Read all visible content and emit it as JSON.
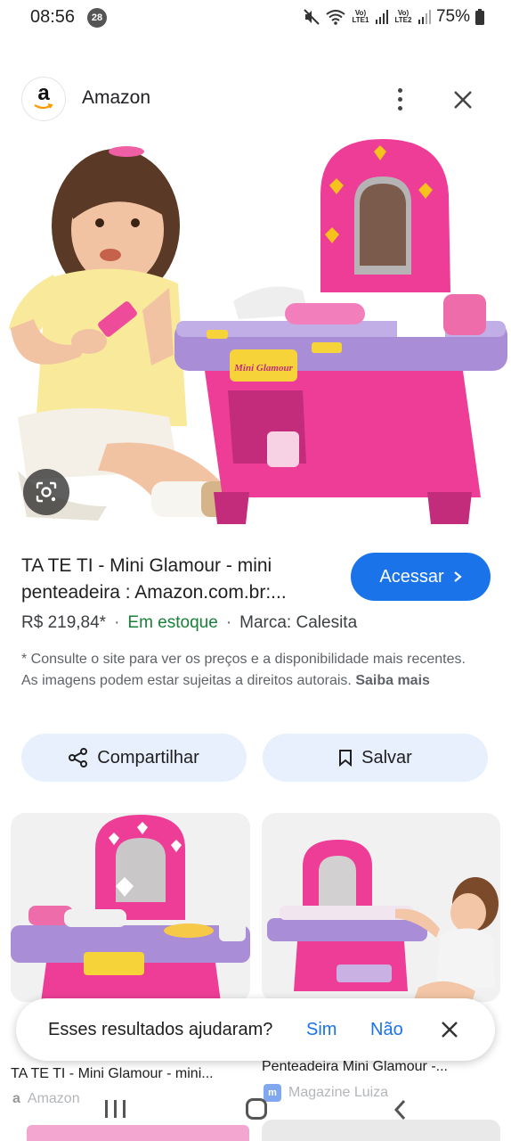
{
  "status_bar": {
    "time": "08:56",
    "notification_count": "28",
    "battery": "75%",
    "net1": "Vo) LTE1",
    "net2": "Vo) LTE2"
  },
  "header": {
    "site_name": "Amazon",
    "logo_letter": "a"
  },
  "result": {
    "title": "TA TE TI - Mini Glamour - mini penteadeira : Amazon.com.br:...",
    "visit_label": "Acessar",
    "price": "R$ 219,84*",
    "stock": "Em estoque",
    "brand": "Marca: Calesita",
    "disclaimer": "* Consulte o site para ver os preços e a disponibilidade mais recentes. As imagens podem estar sujeitas a direitos autorais.",
    "learn_more": "Saiba mais"
  },
  "actions": {
    "share_label": "Compartilhar",
    "save_label": "Salvar"
  },
  "related": [
    {
      "title": "TA TE TI - Mini Glamour - mini...",
      "source": "Amazon"
    },
    {
      "title": "Penteadeira Mini Glamour -...",
      "source": "Magazine Luiza"
    }
  ],
  "feedback": {
    "question": "Esses resultados ajudaram?",
    "yes": "Sim",
    "no": "Não"
  },
  "toy_label": "Mini Glamour",
  "colors": {
    "accent": "#1a73e8",
    "in_stock": "#188038",
    "chip_bg": "#e8f0fe",
    "toy_pink": "#ee3d96",
    "toy_purple": "#a98dd6"
  }
}
